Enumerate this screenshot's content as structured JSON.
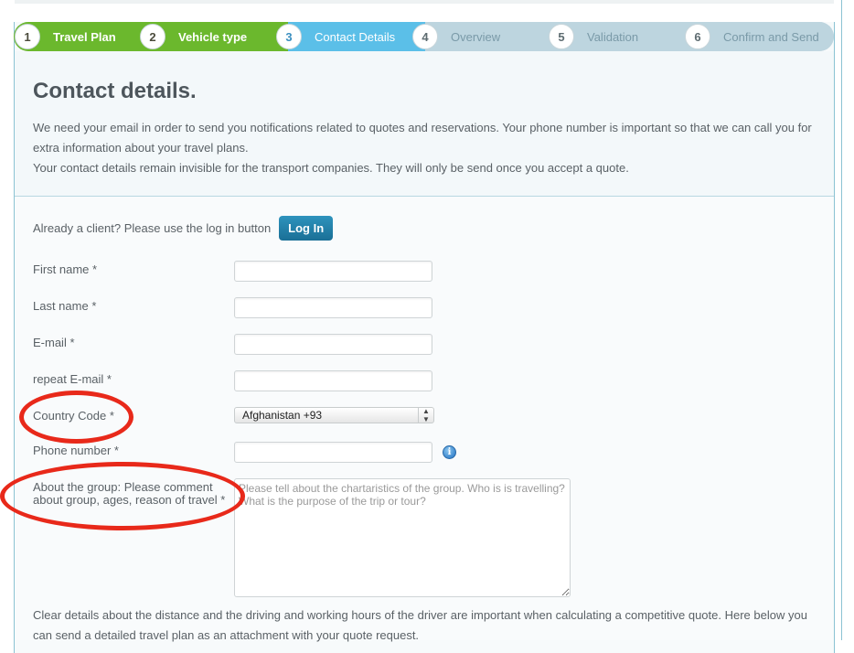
{
  "stepper": {
    "steps": [
      {
        "number": "1",
        "label": "Travel Plan",
        "state": "done"
      },
      {
        "number": "2",
        "label": "Vehicle type",
        "state": "done"
      },
      {
        "number": "3",
        "label": "Contact Details",
        "state": "active"
      },
      {
        "number": "4",
        "label": "Overview",
        "state": "todo"
      },
      {
        "number": "5",
        "label": "Validation",
        "state": "todo"
      },
      {
        "number": "6",
        "label": "Confirm and Send",
        "state": "todo"
      }
    ],
    "colors": {
      "done": "#6bb82d",
      "active": "#5bbfe8",
      "todo": "#bdd5df"
    }
  },
  "intro": {
    "title": "Contact details.",
    "paragraphs": [
      "We need your email in order to send you notifications related to quotes and reservations. Your phone number is important so that we can call you for extra information about your travel plans.",
      "Your contact details remain invisible for the transport companies. They will only be send once you  accept a quote."
    ]
  },
  "login": {
    "prompt": "Already a client? Please use the log in button",
    "button_label": "Log In"
  },
  "form": {
    "first_name": {
      "label": "First name *",
      "value": ""
    },
    "last_name": {
      "label": "Last name *",
      "value": ""
    },
    "email": {
      "label": "E-mail *",
      "value": ""
    },
    "repeat_email": {
      "label": "repeat E-mail  *",
      "value": ""
    },
    "country_code": {
      "label": "Country Code  *",
      "selected": "Afghanistan +93"
    },
    "phone": {
      "label": "Phone number *",
      "value": "",
      "info_icon": "info-icon"
    },
    "about_group": {
      "label_line1": "About the group: Please comment",
      "label_line2": "about group, ages, reason of travel *",
      "placeholder": "Please tell about the chartaristics of the group. Who is is travelling? What is the purpose of the trip or tour?",
      "value": ""
    }
  },
  "bottom": {
    "paragraph": "Clear details about the distance and the driving and working hours of the driver are important when calculating a competitive quote. Here below you can send a detailed travel plan as an attachment with your quote request."
  },
  "annotations": {
    "color": "#e8291a",
    "highlighted": [
      "Country Code",
      "About the group"
    ]
  }
}
